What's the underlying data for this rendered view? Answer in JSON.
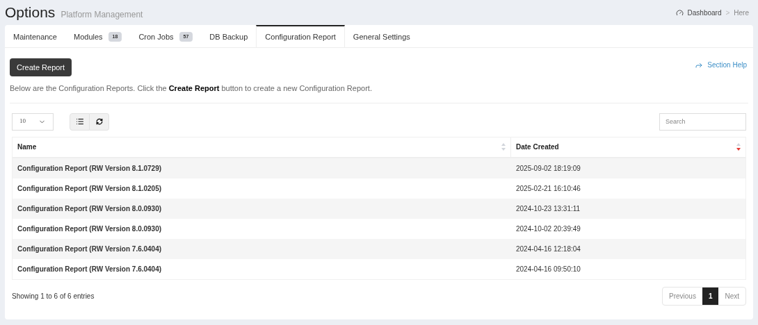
{
  "header": {
    "title": "Options",
    "subtitle": "Platform Management",
    "breadcrumb": [
      "Dashboard",
      "Here"
    ],
    "separator": ">"
  },
  "tabs": [
    {
      "label": "Maintenance",
      "selected": false
    },
    {
      "label": "Modules",
      "badge": "18",
      "selected": false
    },
    {
      "label": "Cron Jobs",
      "badge": "57",
      "selected": false
    },
    {
      "label": "DB Backup",
      "selected": false
    },
    {
      "label": "Configuration Report",
      "selected": true
    },
    {
      "label": "General Settings",
      "selected": false
    }
  ],
  "create_button": "Create Report",
  "section_help": "Section Help",
  "description": "Below are the Configuration Reports. Click the **Create Report** button to create a new Configuration Report.",
  "page_size": "10",
  "search": {
    "placeholder": "Search"
  },
  "table": {
    "columns": [
      {
        "label": "Name",
        "sorted": false
      },
      {
        "label": "Date Created",
        "sorted": true
      }
    ],
    "rows": [
      [
        "Configuration Report (RW Version 8.1.0729)",
        "2025-09-02 18:19:09"
      ],
      [
        "Configuration Report (RW Version 8.1.0205)",
        "2025-02-21 16:10:46"
      ],
      [
        "Configuration Report (RW Version 8.0.0930)",
        "2024-10-23 13:31:11"
      ],
      [
        "Configuration Report (RW Version 8.0.0930)",
        "2024-10-02 20:39:49"
      ],
      [
        "Configuration Report (RW Version 7.6.0404)",
        "2024-04-16 12:18:04"
      ],
      [
        "Configuration Report (RW Version 7.6.0404)",
        "2024-04-16 09:50:10"
      ]
    ]
  },
  "footer": {
    "info": "Showing 1 to 6 of 6 entries",
    "previous": "Previous",
    "next": "Next",
    "pages": [
      {
        "label": "1",
        "selected": true
      }
    ]
  }
}
